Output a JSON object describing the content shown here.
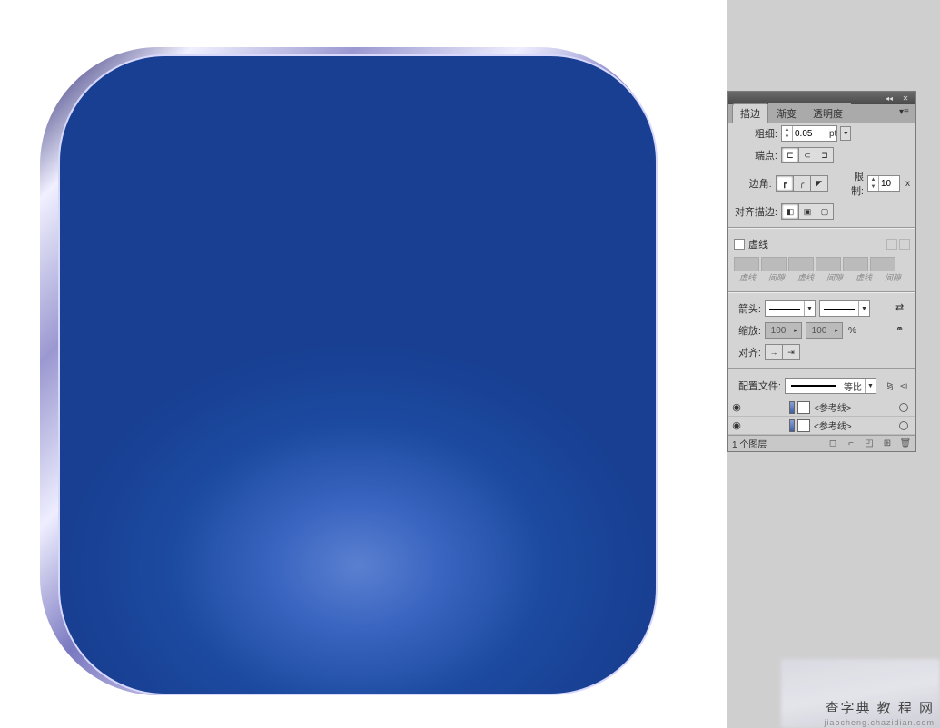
{
  "artwork": {
    "fill_color": "#1b4498",
    "bevel_gradient": "metallic-violet"
  },
  "panel": {
    "tabs": {
      "stroke": "描边",
      "gradient": "渐变",
      "transparency": "透明度"
    },
    "weight_label": "粗细:",
    "weight_value": "0.05",
    "weight_unit": "pt",
    "cap_label": "端点:",
    "corner_label": "边角:",
    "limit_label": "限制:",
    "limit_value": "10",
    "limit_unit": "x",
    "align_label": "对齐描边:",
    "dashed_label": "虚线",
    "dash_cols": [
      "虚线",
      "间隙",
      "虚线",
      "间隙",
      "虚线",
      "间隙"
    ],
    "arrow_label": "箭头:",
    "scale_label": "缩放:",
    "scale_a": "100",
    "scale_b": "100",
    "scale_unit": "%",
    "align2_label": "对齐:",
    "profile_label": "配置文件:",
    "profile_value": "等比"
  },
  "layers": {
    "rows": [
      {
        "name": "<参考线>"
      },
      {
        "name": "<参考线>"
      }
    ],
    "footer": "1 个图层"
  },
  "watermark": {
    "line1": "查字典 教 程 网",
    "line2": "jiaocheng.chazidian.com"
  }
}
